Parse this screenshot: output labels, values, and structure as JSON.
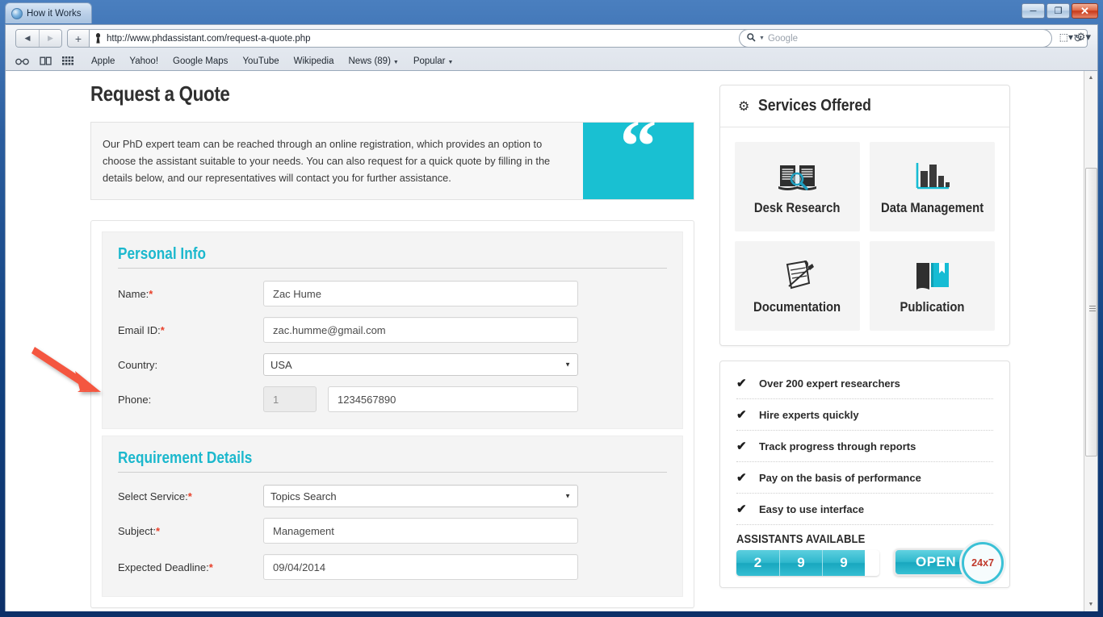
{
  "window": {
    "tab_title": "How it Works",
    "minimize_label": "─",
    "maximize_label": "❐",
    "close_label": "✕"
  },
  "browser": {
    "back_label": "◀",
    "forward_label": "▶",
    "add_tab_label": "+",
    "url": "http://www.phdassistant.com/request-a-quote.php",
    "reload_label": "↻",
    "search_placeholder": "Google",
    "search_glass": "⚲",
    "search_caret": "▼",
    "page_icon_label": "⬚▾",
    "gear_icon_label": "⚙▾",
    "bookmark_icons": [
      "reader-glasses-icon",
      "open-book-icon",
      "grid-icon"
    ],
    "bookmarks": [
      {
        "label": "Apple",
        "caret": false
      },
      {
        "label": "Yahoo!",
        "caret": false
      },
      {
        "label": "Google Maps",
        "caret": false
      },
      {
        "label": "YouTube",
        "caret": false
      },
      {
        "label": "Wikipedia",
        "caret": false
      },
      {
        "label": "News (89)",
        "caret": true
      },
      {
        "label": "Popular",
        "caret": true
      }
    ],
    "caret_glyph": "▼"
  },
  "page": {
    "title": "Request a Quote",
    "intro": "Our PhD expert team can be reached through an online registration, which provides an option to choose the assistant suitable to your needs. You can also request for a quick quote by filling in the details below, and our representatives will contact you for further assistance.",
    "quote_glyph": "“"
  },
  "form": {
    "personal": {
      "legend": "Personal Info",
      "name_label": "Name:",
      "name_value": "Zac Hume",
      "email_label": "Email ID:",
      "email_value": "zac.humme@gmail.com",
      "country_label": "Country:",
      "country_value": "USA",
      "phone_label": "Phone:",
      "phone_code": "1",
      "phone_value": "1234567890",
      "required_mark": "*"
    },
    "requirement": {
      "legend": "Requirement Details",
      "service_label": "Select Service:",
      "service_value": "Topics Search",
      "subject_label": "Subject:",
      "subject_value": "Management",
      "deadline_label": "Expected Deadline:",
      "deadline_value": "09/04/2014",
      "required_mark": "*"
    },
    "select_caret": "▼"
  },
  "services": {
    "heading": "Services Offered",
    "gear_glyph": "⚙",
    "tiles": [
      {
        "label": "Desk Research",
        "icon": "book-magnifier-icon"
      },
      {
        "label": "Data Management",
        "icon": "bar-chart-icon"
      },
      {
        "label": "Documentation",
        "icon": "notepad-pencil-icon"
      },
      {
        "label": "Publication",
        "icon": "books-bookmark-icon"
      }
    ]
  },
  "features": {
    "check_glyph": "✔",
    "items": [
      "Over 200 expert researchers",
      "Hire experts quickly",
      "Track progress through reports",
      "Pay on the basis of performance",
      "Easy to use interface"
    ]
  },
  "availability": {
    "title": "ASSISTANTS AVAILABLE",
    "digits": [
      "2",
      "9",
      "9"
    ],
    "open_label": "OPEN",
    "badge_label": "24x7"
  },
  "annotation": {
    "arrow_color": "#f4573f"
  },
  "colors": {
    "teal": "#19c0d2",
    "teal_dark": "#1cb8cd",
    "required_red": "#e8402a",
    "badge_red": "#c0392b"
  }
}
